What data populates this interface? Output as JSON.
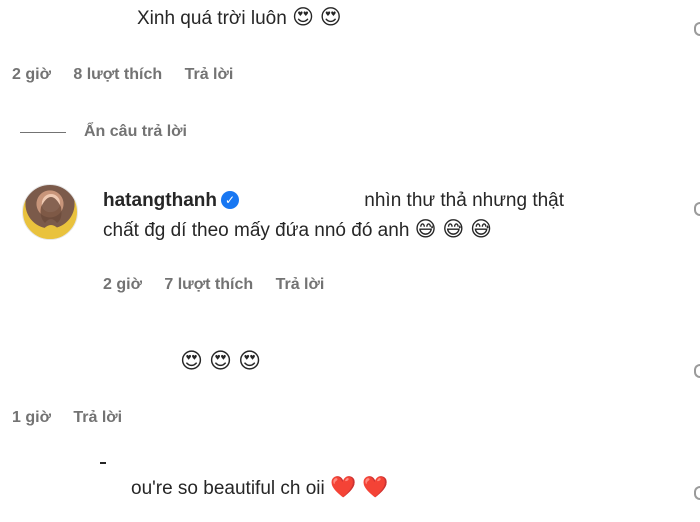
{
  "comments": [
    {
      "text": "Xinh quá trời luôn",
      "emoji": "😍 😍",
      "time": "2 giờ",
      "likes": "8 lượt thích",
      "reply": "Trả lời"
    },
    {
      "hide_replies": "Ẩn câu trả lời"
    },
    {
      "username": "hatangthanh",
      "text_line1": "nhìn thư thả nhưng thật",
      "text_line2": "chất đg dí theo mấy đứa nnó đó anh",
      "emoji": "😅 😅 😅",
      "time": "2 giờ",
      "likes": "7 lượt thích",
      "reply": "Trả lời"
    },
    {
      "emoji": "😍 😍 😍",
      "time": "1 giờ",
      "reply": "Trả lời"
    },
    {
      "text": "ou're so beautiful ch oii",
      "emoji": "❤️ ❤️"
    }
  ]
}
